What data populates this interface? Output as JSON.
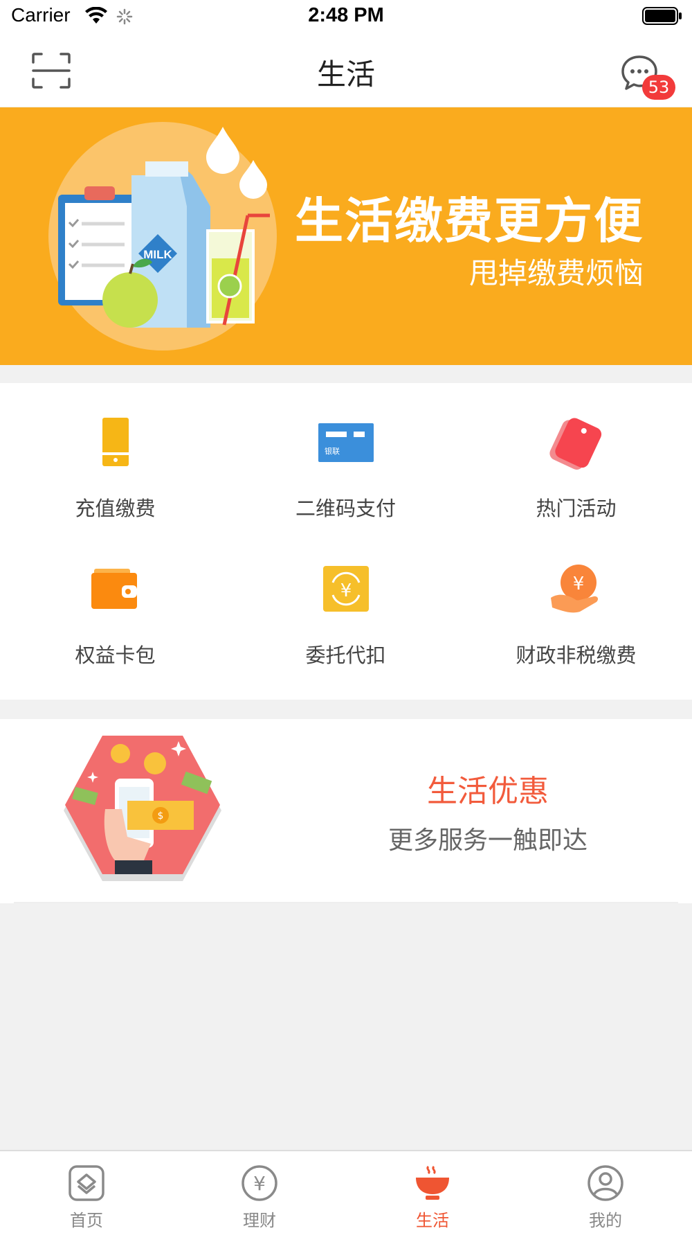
{
  "status_bar": {
    "carrier": "Carrier",
    "time": "2:48 PM"
  },
  "nav": {
    "title": "生活",
    "badge": "53"
  },
  "banner": {
    "title": "生活缴费更方便",
    "subtitle": "甩掉缴费烦恼",
    "illustration_text": "MILK",
    "color": "#faab1e"
  },
  "grid": {
    "items": [
      {
        "label": "充值缴费",
        "icon": "phone-icon"
      },
      {
        "label": "二维码支付",
        "icon": "unionpay-card-icon",
        "icon_text": "银联"
      },
      {
        "label": "热门活动",
        "icon": "tag-icon"
      },
      {
        "label": "权益卡包",
        "icon": "wallet-icon"
      },
      {
        "label": "委托代扣",
        "icon": "yen-cycle-icon",
        "icon_text": "¥"
      },
      {
        "label": "财政非税缴费",
        "icon": "yen-hand-icon",
        "icon_text": "¥"
      }
    ]
  },
  "promo": {
    "title": "生活优惠",
    "subtitle": "更多服务一触即达",
    "accent": "#f25b3c"
  },
  "tabs": [
    {
      "label": "首页",
      "icon": "home-icon",
      "active": false
    },
    {
      "label": "理财",
      "icon": "yen-circle-icon",
      "icon_text": "¥",
      "active": false
    },
    {
      "label": "生活",
      "icon": "bowl-icon",
      "active": true
    },
    {
      "label": "我的",
      "icon": "profile-icon",
      "active": false
    }
  ]
}
